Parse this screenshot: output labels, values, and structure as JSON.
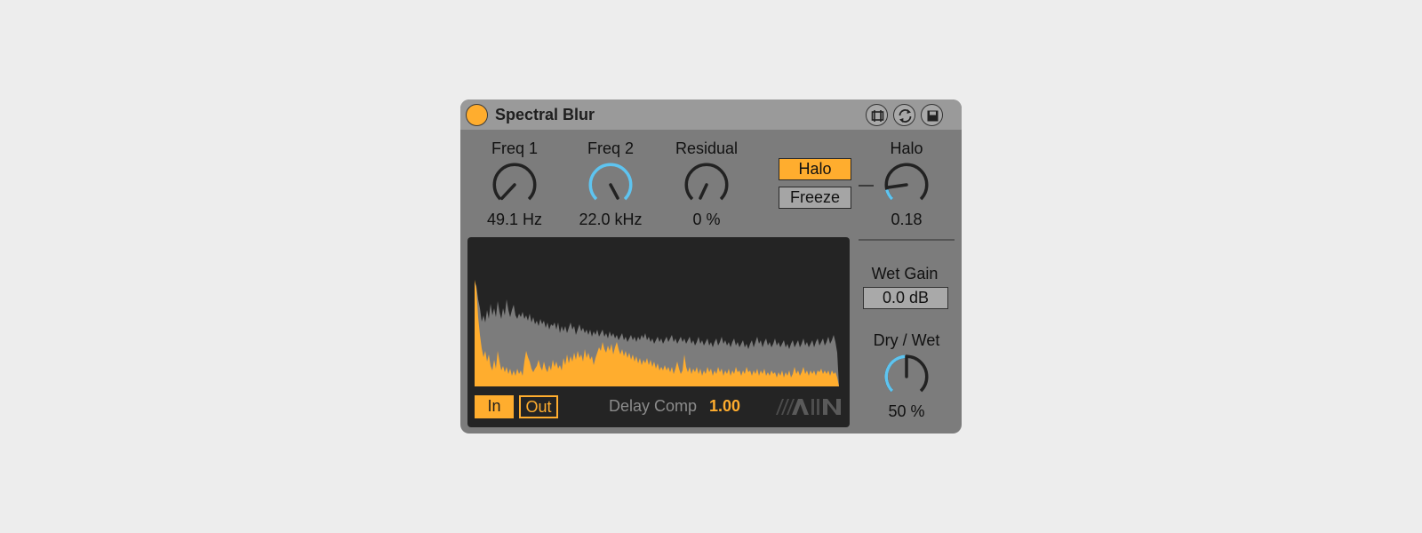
{
  "device": {
    "title": "Spectral Blur",
    "header_icons": [
      "hot-swap-icon",
      "refresh-icon",
      "save-icon"
    ]
  },
  "knobs": {
    "freq1": {
      "label": "Freq 1",
      "value": "49.1 Hz"
    },
    "freq2": {
      "label": "Freq 2",
      "value": "22.0 kHz"
    },
    "residual": {
      "label": "Residual",
      "value": "0 %"
    },
    "halo": {
      "label": "Halo",
      "value": "0.18"
    },
    "drywet": {
      "label": "Dry / Wet",
      "value": "50 %"
    }
  },
  "toggles": {
    "halo": "Halo",
    "freeze": "Freeze"
  },
  "display": {
    "in_label": "In",
    "out_label": "Out",
    "delay_comp_label": "Delay Comp",
    "delay_comp_value": "1.00",
    "logo_text": "AIN"
  },
  "wet_gain": {
    "label": "Wet Gain",
    "value": "0.0 dB"
  },
  "colors": {
    "accent": "#ffad2e",
    "knob_active": "#5ec4f0",
    "panel": "#7c7c7c",
    "display_bg": "#242424"
  }
}
